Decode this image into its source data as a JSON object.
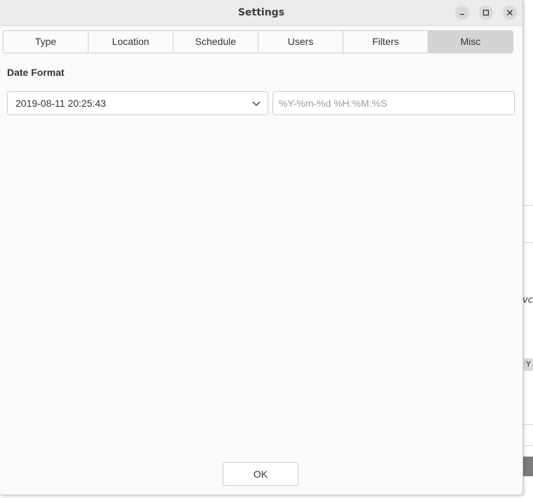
{
  "window": {
    "title": "Settings",
    "controls": {
      "minimize": "minimize-icon",
      "maximize": "maximize-icon",
      "close": "close-icon"
    }
  },
  "tabs": [
    {
      "label": "Type",
      "active": false
    },
    {
      "label": "Location",
      "active": false
    },
    {
      "label": "Schedule",
      "active": false
    },
    {
      "label": "Users",
      "active": false
    },
    {
      "label": "Filters",
      "active": false
    },
    {
      "label": "Misc",
      "active": true
    }
  ],
  "misc": {
    "date_format_label": "Date Format",
    "date_format_selected": "2019-08-11 20:25:43",
    "custom_format_value": "",
    "custom_format_placeholder": "%Y-%m-%d %H:%M:%S"
  },
  "footer": {
    "ok_label": "OK"
  },
  "background_window": {
    "partial_text": "vcr",
    "partial_chip": "Y"
  },
  "colors": {
    "titlebar": "#ebebeb",
    "active_tab": "#d4d4d4",
    "dialog_bg": "#fafafa"
  }
}
